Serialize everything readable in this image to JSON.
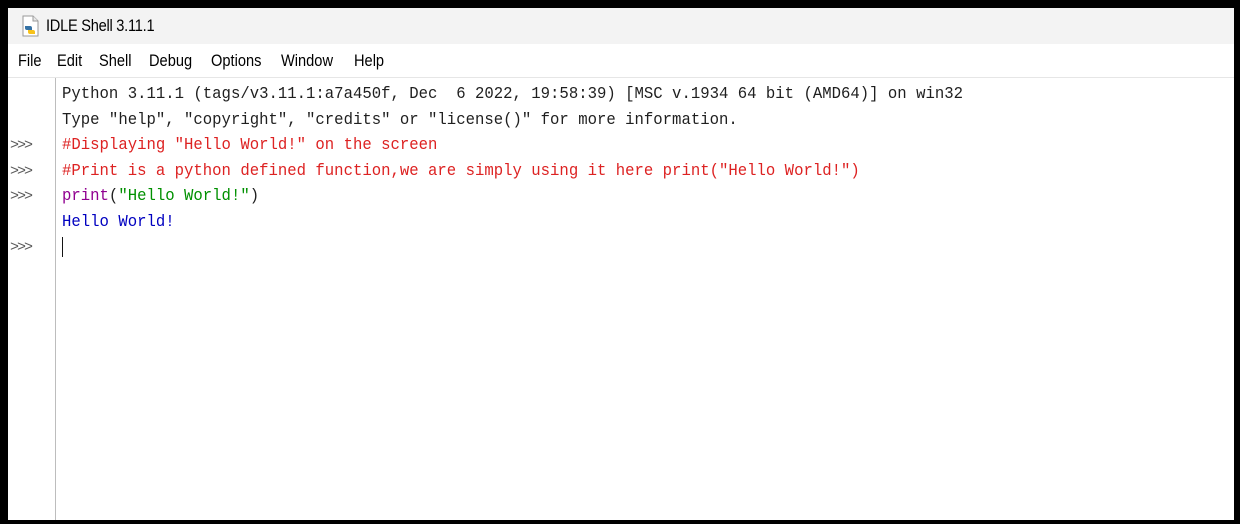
{
  "window": {
    "title": "IDLE Shell 3.11.1",
    "icon": "python-file-icon"
  },
  "menu": {
    "items": [
      "File",
      "Edit",
      "Shell",
      "Debug",
      "Options",
      "Window",
      "Help"
    ]
  },
  "shell": {
    "prompt": ">>>",
    "banner": [
      "Python 3.11.1 (tags/v3.11.1:a7a450f, Dec  6 2022, 19:58:39) [MSC v.1934 64 bit (AMD64)] on win32",
      "Type \"help\", \"copyright\", \"credits\" or \"license()\" for more information."
    ],
    "comment1": "#Displaying \"Hello World!\" on the screen",
    "comment2": "#Print is a python defined function,we are simply using it here print(\"Hello World!\")",
    "code": {
      "func": "print",
      "open": "(",
      "string": "\"Hello World!\"",
      "close": ")"
    },
    "output": "Hello World!"
  },
  "colors": {
    "comment": "#dd2222",
    "builtin": "#900090",
    "string": "#009000",
    "output": "#0000c0",
    "stdout": "#1f1f1f"
  }
}
